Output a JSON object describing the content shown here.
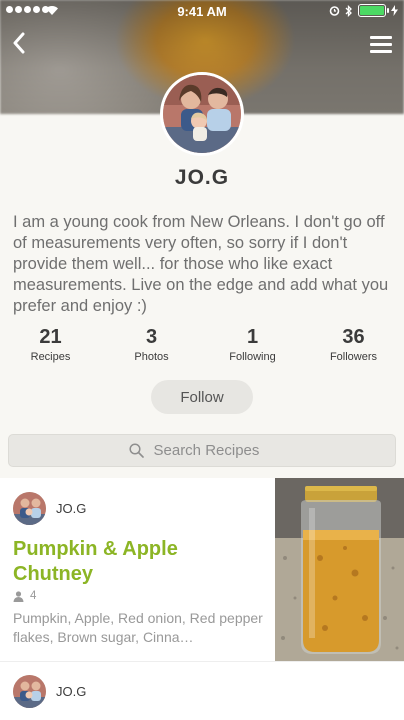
{
  "status_bar": {
    "time": "9:41 AM"
  },
  "profile": {
    "name": "JO.G",
    "bio": "I am a young cook from New Orleans. I don't go off of measurements very often, so sorry if I don't provide them well... for those who like exact measurements. Live on the edge and add what you prefer and enjoy :)",
    "stats": [
      {
        "value": "21",
        "label": "Recipes"
      },
      {
        "value": "3",
        "label": "Photos"
      },
      {
        "value": "1",
        "label": "Following"
      },
      {
        "value": "36",
        "label": "Followers"
      }
    ],
    "follow_label": "Follow"
  },
  "search": {
    "placeholder": "Search Recipes"
  },
  "recipes": [
    {
      "author": "JO.G",
      "title": "Pumpkin & Apple Chutney",
      "servings": "4",
      "ingredients": "Pumpkin, Apple, Red onion, Red pepper flakes, Brown sugar, Cinna…"
    },
    {
      "author": "JO.G"
    }
  ],
  "icons": {
    "back": "chevron-left-icon",
    "menu": "hamburger-menu-icon",
    "search": "search-icon",
    "servings": "person-icon"
  },
  "colors": {
    "accent_green": "#8cb525",
    "battery_green": "#4cd964"
  }
}
